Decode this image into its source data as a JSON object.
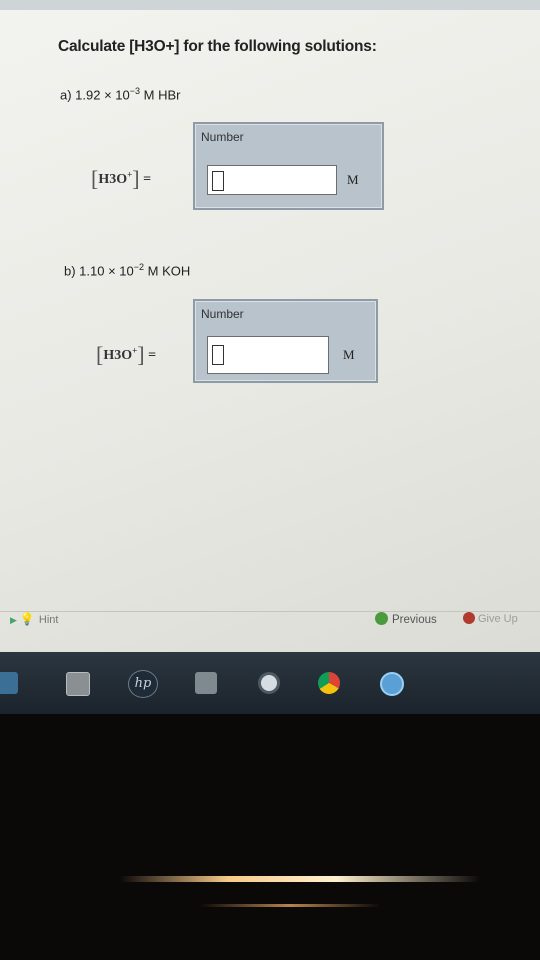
{
  "question": {
    "title": "Calculate [H3O+] for the following solutions:"
  },
  "problems": [
    {
      "label_prefix": "a) 1.92 × 10",
      "exponent": "−3",
      "label_suffix": " M HBr",
      "panel_header": "Number",
      "expr_species": "H3O",
      "expr_charge": "+",
      "equals": "=",
      "unit": "M",
      "value": ""
    },
    {
      "label_prefix": "b) 1.10 × 10",
      "exponent": "−2",
      "label_suffix": " M KOH",
      "panel_header": "Number",
      "expr_species": "H3O",
      "expr_charge": "+",
      "equals": "=",
      "unit": "M",
      "value": ""
    }
  ],
  "footer": {
    "hint_label": "Hint",
    "previous_label": "Previous",
    "give_up_label": "Give Up"
  },
  "taskbar": {
    "icons": [
      "start-icon",
      "file-explorer-icon",
      "hp-icon",
      "app-icon",
      "media-player-icon",
      "chrome-icon",
      "ie-icon"
    ]
  },
  "colors": {
    "panel_bg": "#b9c3cb",
    "previous_icon": "#4c9a3e",
    "give_up_icon": "#b03a2e",
    "taskbar": "#1b242c"
  }
}
